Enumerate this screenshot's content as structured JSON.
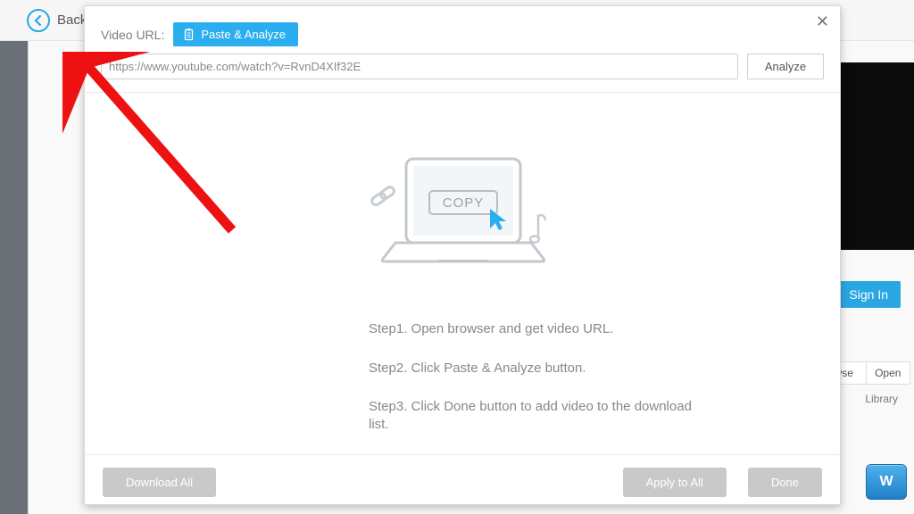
{
  "topbar": {
    "back_label": "Back"
  },
  "modal": {
    "url_label": "Video URL:",
    "paste_btn": "Paste & Analyze",
    "url_value": "https://www.youtube.com/watch?v=RvnD4XIf32E",
    "analyze_btn": "Analyze",
    "copy_label": "COPY",
    "steps": {
      "s1": "Step1. Open browser and get video URL.",
      "s2": "Step2. Click Paste & Analyze button.",
      "s3": "Step3. Click Done button to add video to the download list."
    },
    "footer": {
      "download_all": "Download All",
      "apply_all": "Apply to All",
      "done": "Done"
    }
  },
  "right": {
    "sign_in": "Sign In",
    "browse": "wse",
    "open": "Open",
    "library": "Library",
    "glossy": "W"
  }
}
